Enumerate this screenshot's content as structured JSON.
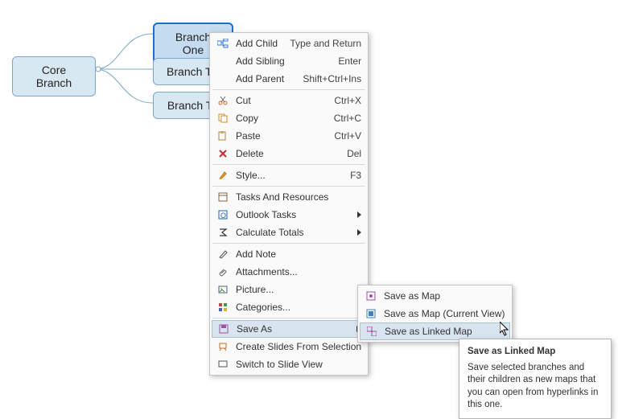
{
  "map": {
    "core": "Core Branch",
    "b1": "Branch One",
    "b2": "Branch Two",
    "b3": "Branch Three"
  },
  "menu": {
    "add_child": {
      "label": "Add Child",
      "shortcut": "Type and Return"
    },
    "add_sibling": {
      "label": "Add Sibling",
      "shortcut": "Enter"
    },
    "add_parent": {
      "label": "Add Parent",
      "shortcut": "Shift+Ctrl+Ins"
    },
    "cut": {
      "label": "Cut",
      "shortcut": "Ctrl+X"
    },
    "copy": {
      "label": "Copy",
      "shortcut": "Ctrl+C"
    },
    "paste": {
      "label": "Paste",
      "shortcut": "Ctrl+V"
    },
    "delete": {
      "label": "Delete",
      "shortcut": "Del"
    },
    "style": {
      "label": "Style...",
      "shortcut": "F3"
    },
    "tasks": {
      "label": "Tasks And Resources"
    },
    "outlook": {
      "label": "Outlook Tasks"
    },
    "calc": {
      "label": "Calculate Totals"
    },
    "note": {
      "label": "Add Note"
    },
    "attach": {
      "label": "Attachments..."
    },
    "picture": {
      "label": "Picture..."
    },
    "categories": {
      "label": "Categories..."
    },
    "saveas": {
      "label": "Save As"
    },
    "slides": {
      "label": "Create Slides From Selection"
    },
    "switch": {
      "label": "Switch to Slide View"
    }
  },
  "submenu": {
    "save_map": "Save as Map",
    "save_map_current": "Save as Map (Current View)",
    "save_linked": "Save as Linked Map"
  },
  "tooltip": {
    "title": "Save as Linked Map",
    "body": "Save selected branches and their children as new maps that you can open from hyperlinks in this one."
  }
}
